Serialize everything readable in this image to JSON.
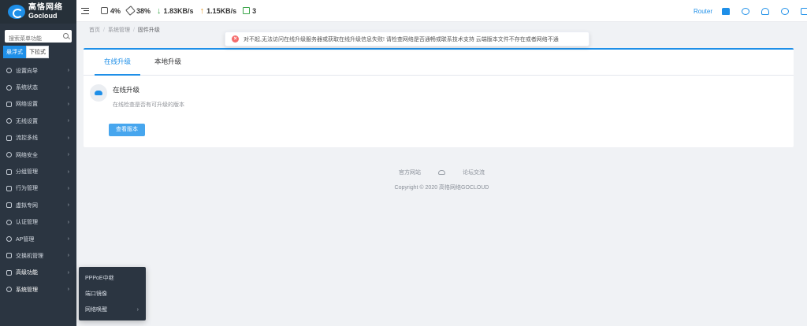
{
  "brand": {
    "name_cn": "高恪网络",
    "name_en": "Gocloud"
  },
  "sidebar": {
    "search_placeholder": "搜索菜单功能",
    "modes": [
      "悬浮式",
      "下拉式"
    ],
    "items": [
      {
        "label": "设置向导",
        "icon": "wizard-icon"
      },
      {
        "label": "系统状态",
        "icon": "dashboard-icon"
      },
      {
        "label": "网络设置",
        "icon": "monitor-icon"
      },
      {
        "label": "无线设置",
        "icon": "wifi-icon"
      },
      {
        "label": "流控多线",
        "icon": "flow-control-icon"
      },
      {
        "label": "网络安全",
        "icon": "shield-icon"
      },
      {
        "label": "分组管理",
        "icon": "group-icon"
      },
      {
        "label": "行为管理",
        "icon": "behavior-icon"
      },
      {
        "label": "虚拟专网",
        "icon": "vpn-icon"
      },
      {
        "label": "认证管理",
        "icon": "auth-icon"
      },
      {
        "label": "AP管理",
        "icon": "ap-icon"
      },
      {
        "label": "交换机管理",
        "icon": "switch-icon"
      },
      {
        "label": "高级功能",
        "icon": "advanced-icon"
      },
      {
        "label": "系统管理",
        "icon": "gear-icon"
      }
    ],
    "submenu": [
      {
        "label": "PPPoE中继"
      },
      {
        "label": "端口镜像"
      },
      {
        "label": "网络唤醒"
      }
    ]
  },
  "topbar": {
    "cpu": "4%",
    "mem": "38%",
    "download": "1.83KB/s",
    "upload": "1.15KB/s",
    "devices": "3",
    "router_link": "Router"
  },
  "breadcrumb": [
    "首页",
    "系统管理",
    "固件升级"
  ],
  "alert": {
    "message": "对不起,无法访问在线升级服务器或获取在线升级信息失败! 请检查网络是否通畅或联系技术支持 云端版本文件不存在或者网络不通"
  },
  "tabs": [
    "在线升级",
    "本地升级"
  ],
  "online_upgrade": {
    "title": "在线升级",
    "description": "在线检查是否有可升级的版本",
    "check_button": "查看版本"
  },
  "footer": {
    "official_site": "官方网站",
    "forum": "论坛交流",
    "copyright": "Copyright © 2020 高恪网络GOCLOUD"
  },
  "colors": {
    "accent": "#1e8fe8",
    "sidebar": "#2b3541",
    "error": "#f56c6c"
  }
}
